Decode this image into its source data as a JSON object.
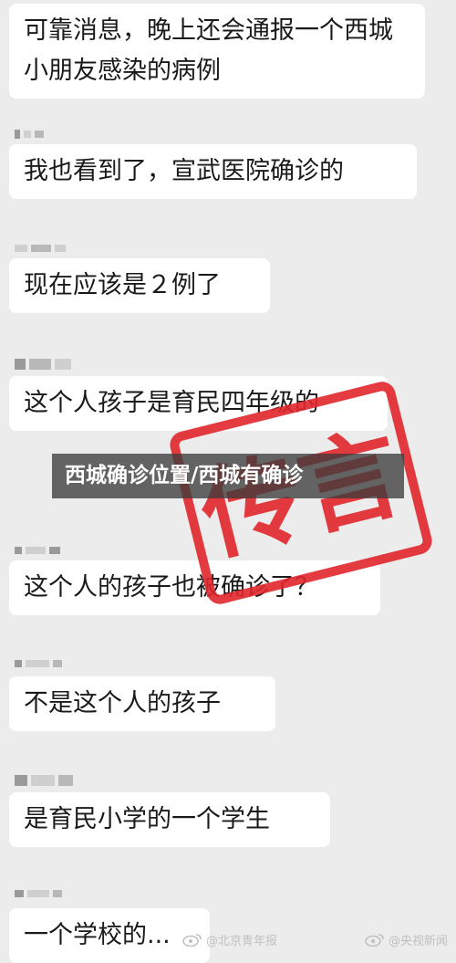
{
  "messages": [
    {
      "text": "可靠消息，晚上还会通报一个西城小朋友感染的病例"
    },
    {
      "text": "我也看到了，宣武医院确诊的"
    },
    {
      "text": "现在应该是２例了"
    },
    {
      "text": "这个人孩子是育民四年级的"
    },
    {
      "text": "这个人的孩子也被确诊了？"
    },
    {
      "text": "不是这个人的孩子"
    },
    {
      "text": "是育民小学的一个学生"
    },
    {
      "text": "一个学校的..."
    }
  ],
  "banner": {
    "text": "西城确诊位置/西城有确诊"
  },
  "stamp": {
    "text": "传言",
    "color": "#e0262c"
  },
  "watermarks": {
    "left": "@北京青年报",
    "right": "@央视新闻"
  }
}
